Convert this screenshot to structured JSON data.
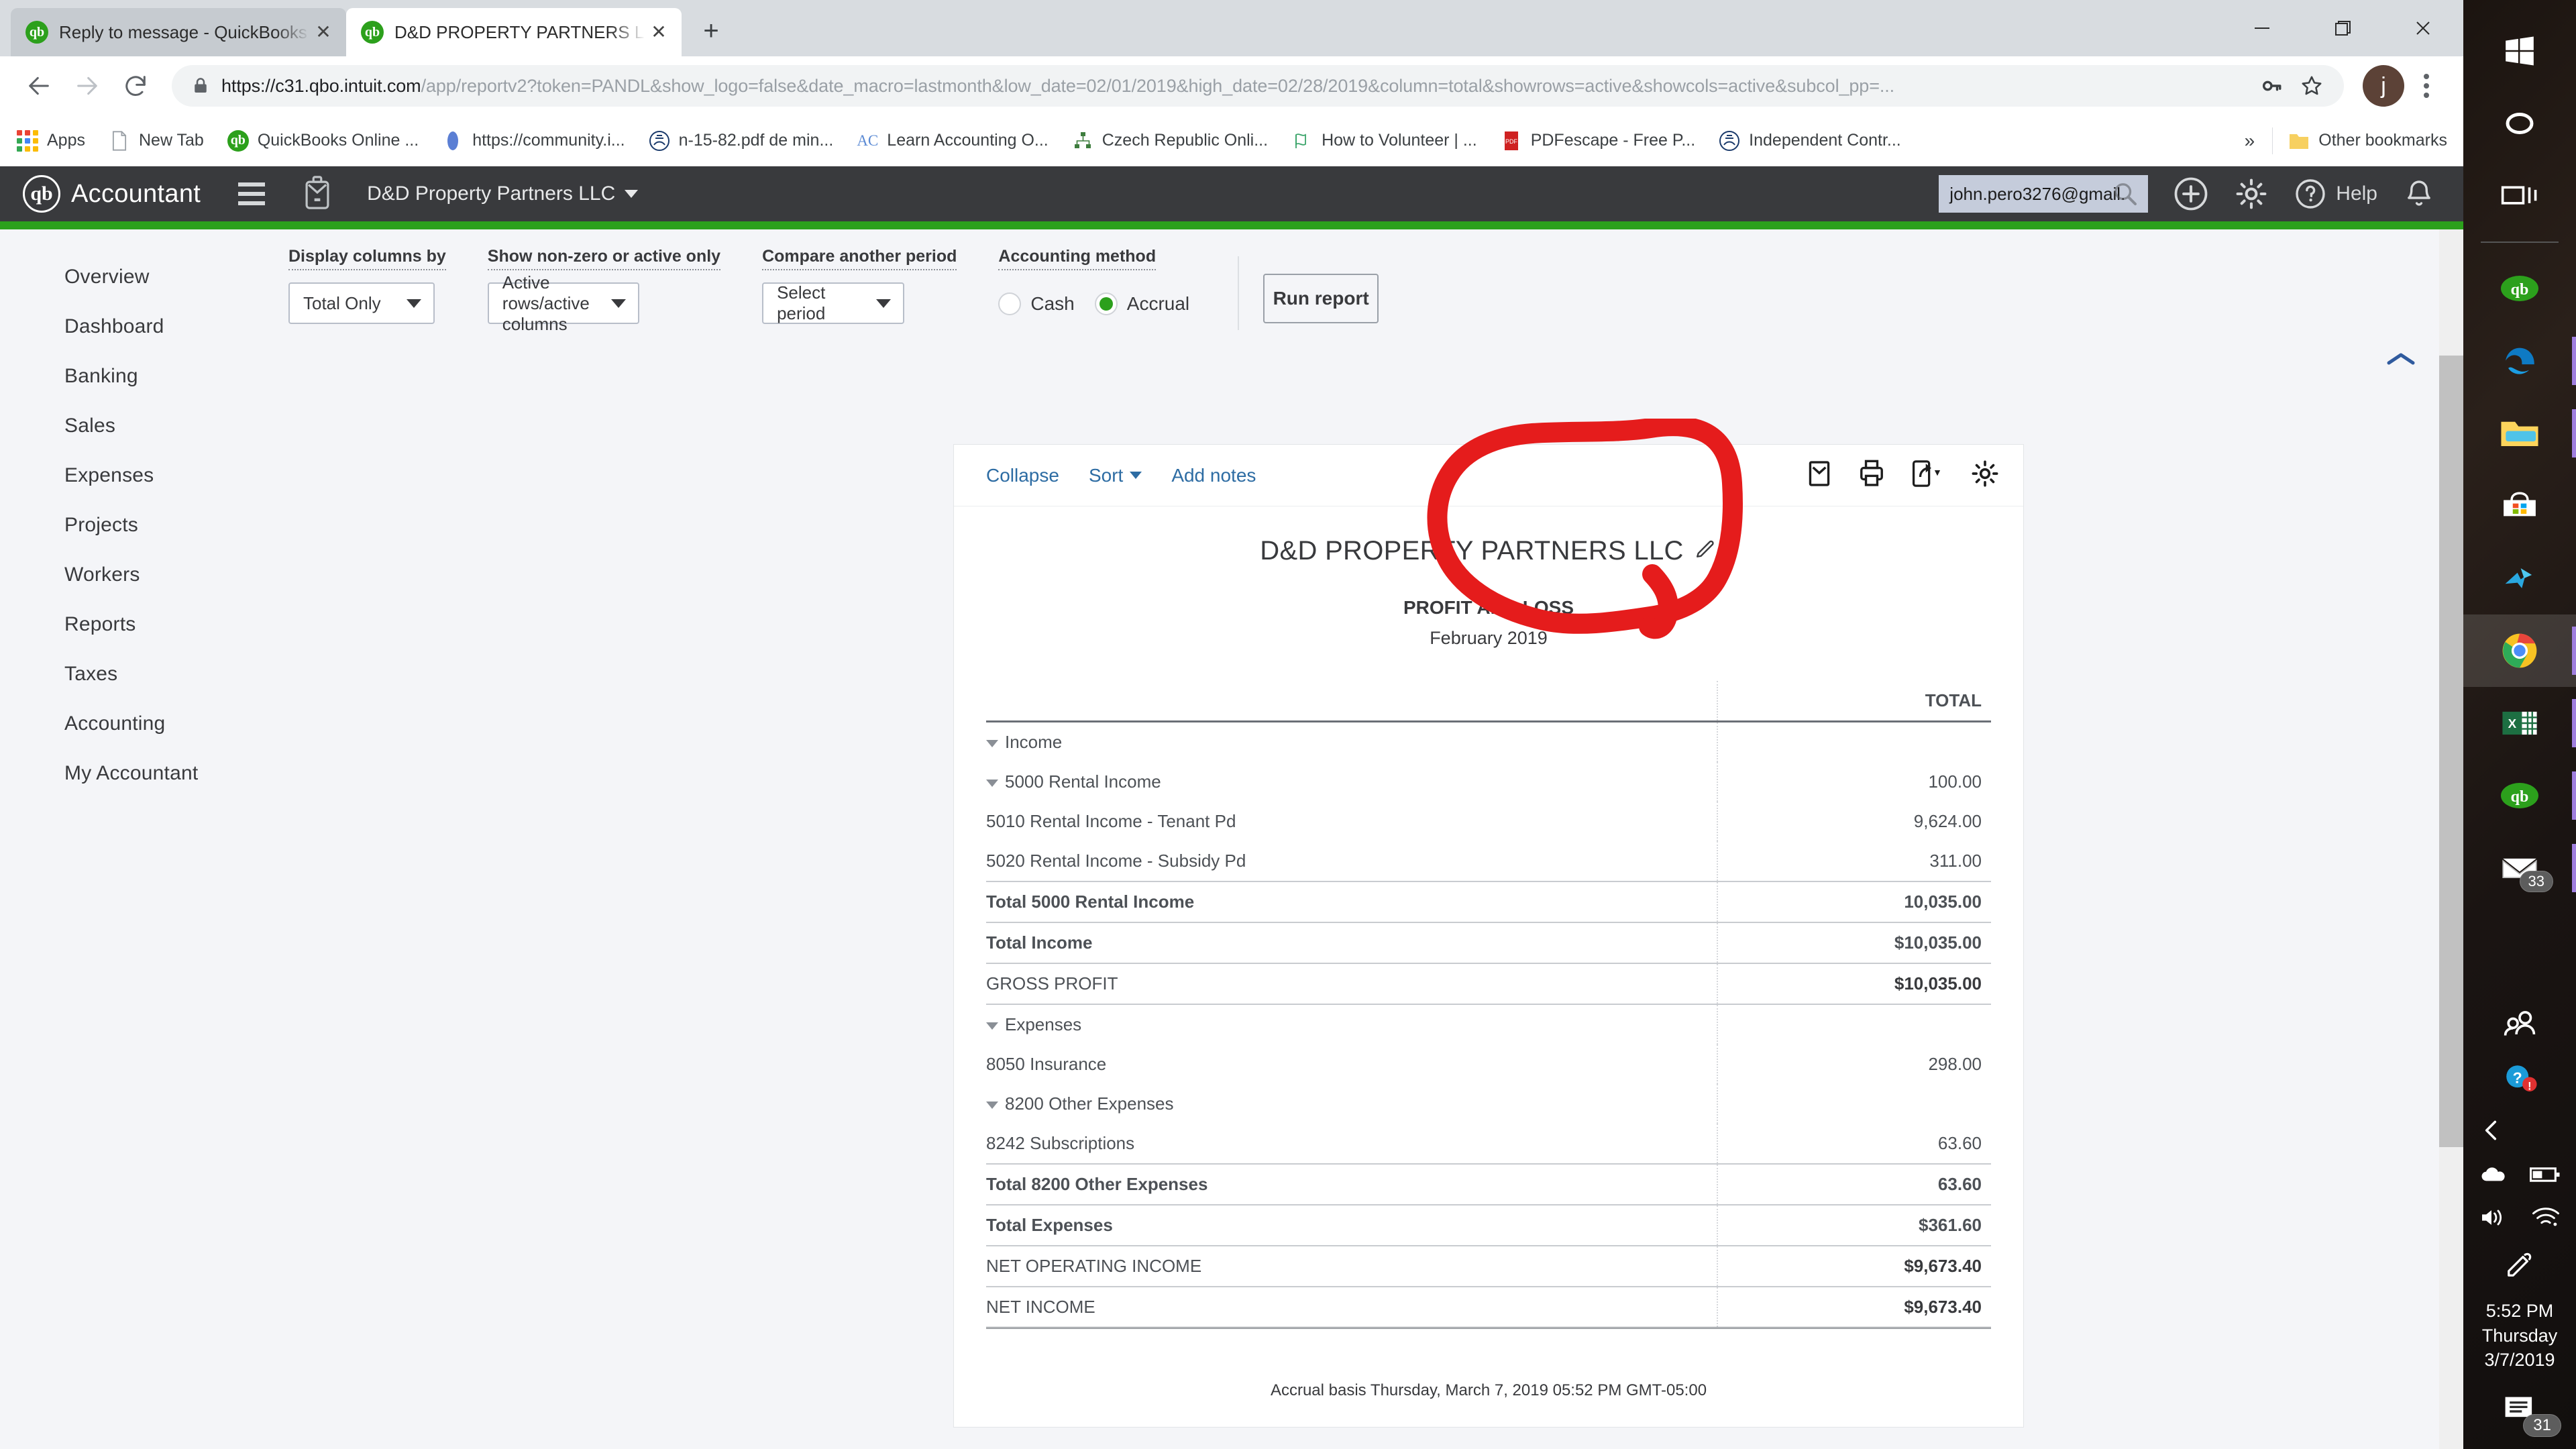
{
  "browser": {
    "tabs": [
      {
        "title": "Reply to message - QuickBooks C",
        "favicon": "quickbooks-icon",
        "active": false
      },
      {
        "title": "D&D PROPERTY PARTNERS LLC -",
        "favicon": "quickbooks-icon",
        "active": true
      }
    ],
    "new_tab_label": "+",
    "window_controls": {
      "minimize": "—",
      "maximize": "❐",
      "close": "✕"
    },
    "nav": {
      "back": "←",
      "forward": "→",
      "reload": "↻"
    },
    "url": {
      "scheme": "https://",
      "host": "c31.qbo.intuit.com",
      "path": "/app/reportv2?token=PANDL&show_logo=false&date_macro=lastmonth&low_date=02/01/2019&high_date=02/28/2019&column=total&showrows=active&showcols=active&subcol_pp=...",
      "full": "https://c31.qbo.intuit.com/app/reportv2?token=PANDL&show_logo=false&date_macro=lastmonth&low_date=02/01/2019&high_date=02/28/2019&column=total&showrows=active&showcols=active&subcol_pp=..."
    },
    "profile_initial": "j",
    "bookmarks": [
      {
        "label": "Apps",
        "icon": "apps-grid-icon"
      },
      {
        "label": "New Tab",
        "icon": "page-icon"
      },
      {
        "label": "QuickBooks Online ...",
        "icon": "quickbooks-icon"
      },
      {
        "label": "https://community.i...",
        "icon": "blue-oval-icon"
      },
      {
        "label": "n-15-82.pdf de min...",
        "icon": "irs-icon"
      },
      {
        "label": "Learn Accounting O...",
        "icon": "ac-icon"
      },
      {
        "label": "Czech Republic Onli...",
        "icon": "network-icon"
      },
      {
        "label": "How to Volunteer | ...",
        "icon": "map-icon"
      },
      {
        "label": "PDFescape - Free P...",
        "icon": "pdf-icon"
      },
      {
        "label": "Independent Contr...",
        "icon": "irs-icon"
      }
    ],
    "overflow_label": "»",
    "other_bookmarks": {
      "label": "Other bookmarks",
      "icon": "folder-icon"
    }
  },
  "app": {
    "product": "Accountant",
    "logo_text": "qb",
    "company": "D&D Property Partners LLC",
    "email_value": "john.pero3276@gmail.",
    "help_label": "Help",
    "header_icons": [
      "plus-icon",
      "gear-icon",
      "help-circle-icon",
      "bell-icon"
    ]
  },
  "sidebar": {
    "items": [
      {
        "label": "Overview"
      },
      {
        "label": "Dashboard"
      },
      {
        "label": "Banking"
      },
      {
        "label": "Sales"
      },
      {
        "label": "Expenses"
      },
      {
        "label": "Projects"
      },
      {
        "label": "Workers"
      },
      {
        "label": "Reports"
      },
      {
        "label": "Taxes"
      },
      {
        "label": "Accounting"
      },
      {
        "label": "My Accountant"
      }
    ]
  },
  "controls": {
    "display_columns": {
      "label": "Display columns by",
      "value": "Total Only"
    },
    "show_rows": {
      "label": "Show non-zero or active only",
      "value": "Active rows/active columns"
    },
    "compare_period": {
      "label": "Compare another period",
      "value": "Select period"
    },
    "accounting_method": {
      "label": "Accounting method",
      "options": [
        {
          "label": "Cash",
          "selected": false
        },
        {
          "label": "Accrual",
          "selected": true
        }
      ]
    },
    "run_report": "Run report"
  },
  "report_toolbar": {
    "collapse": "Collapse",
    "sort": "Sort",
    "add_notes": "Add notes",
    "icons": [
      "email-icon",
      "print-icon",
      "export-icon",
      "gear-icon"
    ]
  },
  "report": {
    "company": "D&D PROPERTY PARTNERS LLC",
    "edit_icon": "pencil-icon",
    "title": "PROFIT AND LOSS",
    "period": "February 2019",
    "column_header": "TOTAL",
    "basis_note": "Accrual basis  Thursday, March 7, 2019  05:52 PM GMT-05:00",
    "rows": [
      {
        "label": "Income",
        "amount": "",
        "indent": 0,
        "expander": true,
        "bold": false,
        "rule_above": ""
      },
      {
        "label": "5000 Rental Income",
        "amount": "100.00",
        "indent": 1,
        "expander": true,
        "bold": false,
        "rule_above": ""
      },
      {
        "label": "5010 Rental Income - Tenant Pd",
        "amount": "9,624.00",
        "indent": 2,
        "expander": false,
        "bold": false,
        "rule_above": ""
      },
      {
        "label": "5020 Rental Income - Subsidy Pd",
        "amount": "311.00",
        "indent": 2,
        "expander": false,
        "bold": false,
        "rule_above": ""
      },
      {
        "label": "Total 5000 Rental Income",
        "amount": "10,035.00",
        "indent": 2,
        "expander": false,
        "bold": true,
        "rule_above": "light"
      },
      {
        "label": "Total Income",
        "amount": "$10,035.00",
        "indent": 1,
        "expander": false,
        "bold": true,
        "rule_above": "light"
      },
      {
        "label": "GROSS PROFIT",
        "amount": "$10,035.00",
        "indent": 1,
        "expander": false,
        "bold": true,
        "rule_above": "light"
      },
      {
        "label": "Expenses",
        "amount": "",
        "indent": 0,
        "expander": true,
        "bold": false,
        "rule_above": ""
      },
      {
        "label": "8050 Insurance",
        "amount": "298.00",
        "indent": 2,
        "expander": false,
        "bold": false,
        "rule_above": ""
      },
      {
        "label": "8200 Other Expenses",
        "amount": "",
        "indent": 1,
        "expander": true,
        "bold": false,
        "rule_above": ""
      },
      {
        "label": "8242 Subscriptions",
        "amount": "63.60",
        "indent": 2,
        "expander": false,
        "bold": false,
        "rule_above": ""
      },
      {
        "label": "Total 8200 Other Expenses",
        "amount": "63.60",
        "indent": 2,
        "expander": false,
        "bold": true,
        "rule_above": "light"
      },
      {
        "label": "Total Expenses",
        "amount": "$361.60",
        "indent": 1,
        "expander": false,
        "bold": true,
        "rule_above": "light"
      },
      {
        "label": "NET OPERATING INCOME",
        "amount": "$9,673.40",
        "indent": 1,
        "expander": false,
        "bold": true,
        "rule_above": "light"
      },
      {
        "label": "NET INCOME",
        "amount": "$9,673.40",
        "indent": 1,
        "expander": false,
        "bold": true,
        "rule_above": "light"
      }
    ]
  },
  "annotation": {
    "type": "hand-drawn-red-circle",
    "color": "#e51c1c",
    "targets": "Accounting method Cash / Accrual radio group"
  },
  "taskbar": {
    "system": [
      {
        "name": "start-icon"
      },
      {
        "name": "cortana-icon"
      },
      {
        "name": "task-view-icon"
      }
    ],
    "apps": [
      {
        "name": "quickbooks-icon",
        "running": false
      },
      {
        "name": "edge-icon",
        "running": true
      },
      {
        "name": "file-explorer-icon",
        "running": true
      },
      {
        "name": "microsoft-store-icon",
        "running": false
      },
      {
        "name": "sync-icon",
        "running": false
      },
      {
        "name": "chrome-icon",
        "running": true,
        "active": true
      },
      {
        "name": "excel-icon",
        "running": true
      },
      {
        "name": "quickbooks-desktop-icon",
        "running": true
      },
      {
        "name": "mail-icon",
        "running": true,
        "badge": "33"
      }
    ],
    "tray": [
      {
        "name": "people-icon"
      },
      {
        "name": "help-alert-icon"
      },
      {
        "name": "show-hidden-icons-icon"
      },
      {
        "name": "onedrive-icon"
      },
      {
        "name": "battery-icon"
      },
      {
        "name": "volume-icon"
      },
      {
        "name": "wifi-icon"
      },
      {
        "name": "pen-icon"
      }
    ],
    "clock": {
      "time": "5:52 PM",
      "day": "Thursday",
      "date": "3/7/2019"
    },
    "notifications": {
      "icon": "action-center-icon",
      "count": "31"
    }
  }
}
